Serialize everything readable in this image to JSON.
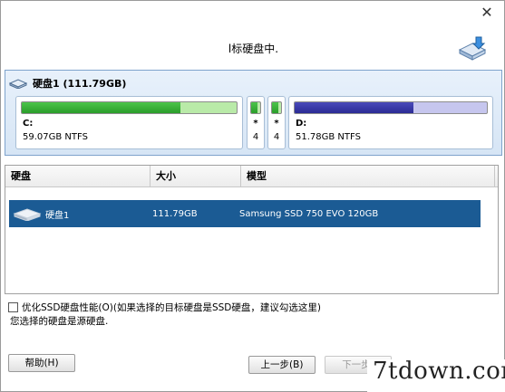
{
  "window": {
    "close_glyph": "✕"
  },
  "header": {
    "title": "l标硬盘中.",
    "icon": "disk-download-icon"
  },
  "disk_panel": {
    "title": "硬盘1 (111.79GB)",
    "partitions": [
      {
        "label": "C:",
        "detail": "59.07GB NTFS",
        "used_fraction": 0.74,
        "color": "#2a9d2a"
      },
      {
        "label": "*",
        "detail": "4",
        "used_fraction": 0.7,
        "color": "#2a9d2a"
      },
      {
        "label": "*",
        "detail": "4",
        "used_fraction": 0.7,
        "color": "#2a9d2a"
      },
      {
        "label": "D:",
        "detail": "51.78GB NTFS",
        "used_fraction": 0.62,
        "color": "#2b2b94"
      }
    ]
  },
  "disk_list": {
    "columns": [
      "硬盘",
      "大小",
      "模型"
    ],
    "rows": [
      {
        "name": "硬盘1",
        "size": "111.79GB",
        "model": "Samsung SSD 750 EVO 120GB",
        "selected": true
      }
    ]
  },
  "options": {
    "ssd_optimize_label": "优化SSD硬盘性能(O)(如果选择的目标硬盘是SSD硬盘，建议勾选这里)",
    "ssd_optimize_checked": false
  },
  "status": {
    "text": "您选择的硬盘是源硬盘."
  },
  "buttons": {
    "help": "帮助(H)",
    "back": "上一步(B)",
    "next": "下一步("
  },
  "watermark": {
    "text": "7tdown.com"
  },
  "colors": {
    "selection": "#1b5b94",
    "panel_border": "#7ea3cc"
  }
}
